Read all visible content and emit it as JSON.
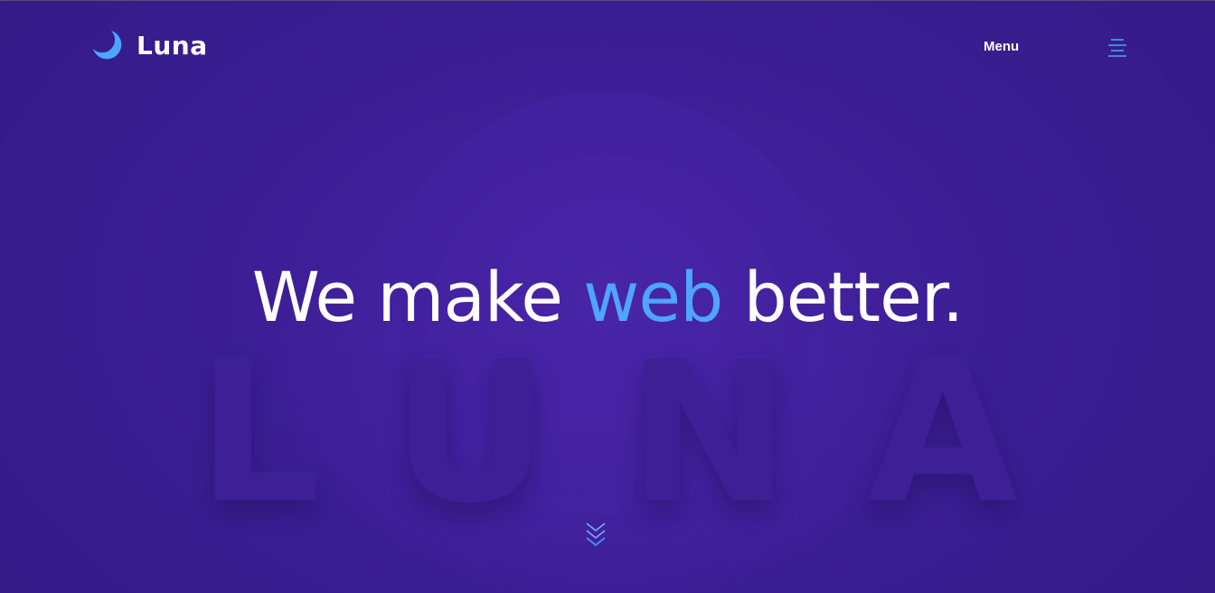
{
  "header": {
    "logo_text": "Luna",
    "menu_label": "Menu",
    "logo_icon": "crescent-moon-icon",
    "menu_icon": "hamburger-icon"
  },
  "hero": {
    "headline_before": "We make ",
    "headline_accent": "web",
    "headline_after": " better.",
    "watermark": "LUNA",
    "scroll_icon": "double-chevron-down-icon"
  },
  "colors": {
    "background": "#3a1f93",
    "accent": "#4ea4ff",
    "text": "#ffffff"
  }
}
